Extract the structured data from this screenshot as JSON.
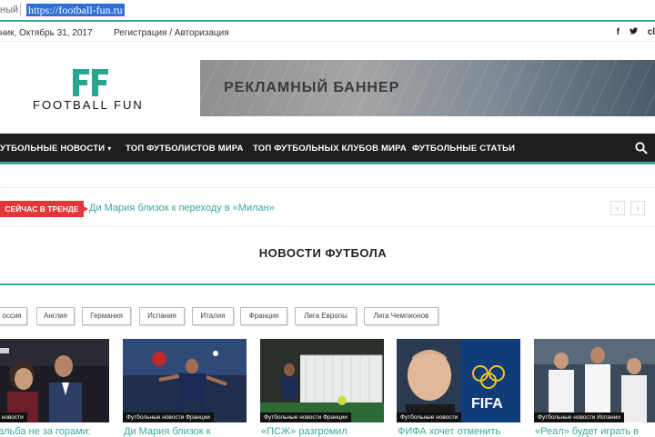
{
  "browser": {
    "security": "ный",
    "url": "https://football-fun.ru"
  },
  "topbar": {
    "date": "ник, Октябрь 31, 2017",
    "auth": "Регистрация / Авторизация",
    "social": [
      "f",
      "y",
      "cl"
    ]
  },
  "logo": {
    "mark": "FF",
    "name": "FOOTBALL FUN"
  },
  "banner": {
    "text": "РЕКЛАМНЫЙ БАННЕР"
  },
  "nav": {
    "items": [
      "УТБОЛЬНЫЕ НОВОСТИ",
      "ТОП ФУТБОЛИСТОВ МИРА",
      "ТОП ФУТБОЛЬНЫХ КЛУБОВ МИРА",
      "ФУТБОЛЬНЫЕ СТАТЬИ"
    ],
    "caret": "▾",
    "search_icon": "search-icon"
  },
  "trending": {
    "badge": "СЕЙЧАС В ТРЕНДЕ",
    "link": "Ди Мария близок к переходу в «Милан»",
    "prev": "‹",
    "next": "›"
  },
  "section": {
    "title": "НОВОСТИ ФУТБОЛА"
  },
  "filters": [
    "оссия",
    "Англия",
    "Германия",
    "Испания",
    "Италия",
    "Франция",
    "Лига Европы",
    "Лига Чемпионов"
  ],
  "cards": [
    {
      "category": "ные новости",
      "caption": "альба не за горами:"
    },
    {
      "category": "Футбольные новости Франции",
      "caption": "Ди Мария близок к"
    },
    {
      "category": "Футбольные новости Франции",
      "caption": "«ПСЖ» разгромил"
    },
    {
      "category": "Футбольные новости",
      "caption": "ФИФА хочет отменить"
    },
    {
      "category": "Футбольные новости Испании",
      "caption": "«Реал» будет играть в"
    }
  ],
  "colors": {
    "accent": "#3aa99a",
    "trend_badge": "#e0373a",
    "nav_bg": "#1e1e1e"
  }
}
